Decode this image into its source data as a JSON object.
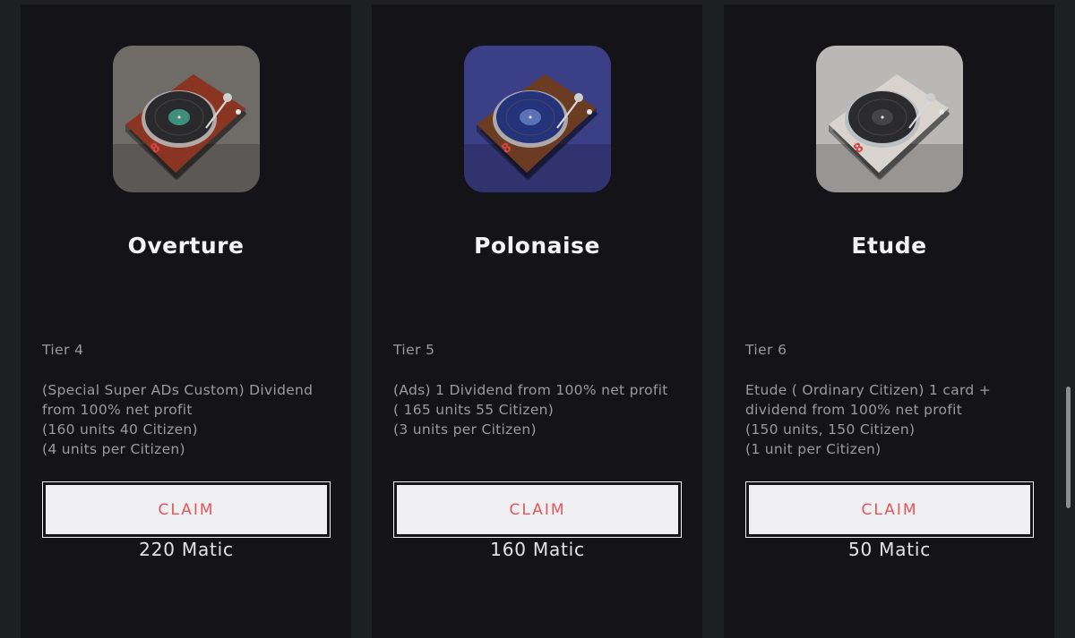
{
  "cards": [
    {
      "title": "Overture",
      "tier": "Tier 4",
      "desc_lines": [
        "(Special Super ADs Custom) Dividend",
        "from 100% net profit",
        "(160 units 40 Citizen)",
        "(4 units per Citizen)"
      ],
      "claim_label": "CLAIM",
      "price": "220 Matic",
      "image": "turntable-wood-red",
      "colors": {
        "bg": "#6f6c68",
        "deck": "#8a3522",
        "platter": "#2a2a2c",
        "label": "#3e8f7c"
      }
    },
    {
      "title": "Polonaise",
      "tier": "Tier 5",
      "desc_lines": [
        "(Ads) 1 Dividend from 100% net profit",
        "( 165 units 55 Citizen)",
        "(3 units per Citizen)"
      ],
      "claim_label": "CLAIM",
      "price": "160 Matic",
      "image": "turntable-wood-blue",
      "colors": {
        "bg": "#3b3f86",
        "deck": "#6b3c22",
        "platter": "#24337a",
        "label": "#5b72b8"
      }
    },
    {
      "title": "Etude",
      "tier": "Tier 6",
      "desc_lines": [
        "Etude ( Ordinary Citizen) 1 card +",
        "dividend from 100% net profit",
        "(150 units, 150 Citizen)",
        "(1 unit per Citizen)"
      ],
      "claim_label": "CLAIM",
      "price": "50 Matic",
      "image": "turntable-white",
      "colors": {
        "bg": "#b9b8b6",
        "deck": "#d8d3cc",
        "platter": "#2b2b2d",
        "label": "#444446"
      }
    }
  ],
  "accent_color": "#e0565b"
}
